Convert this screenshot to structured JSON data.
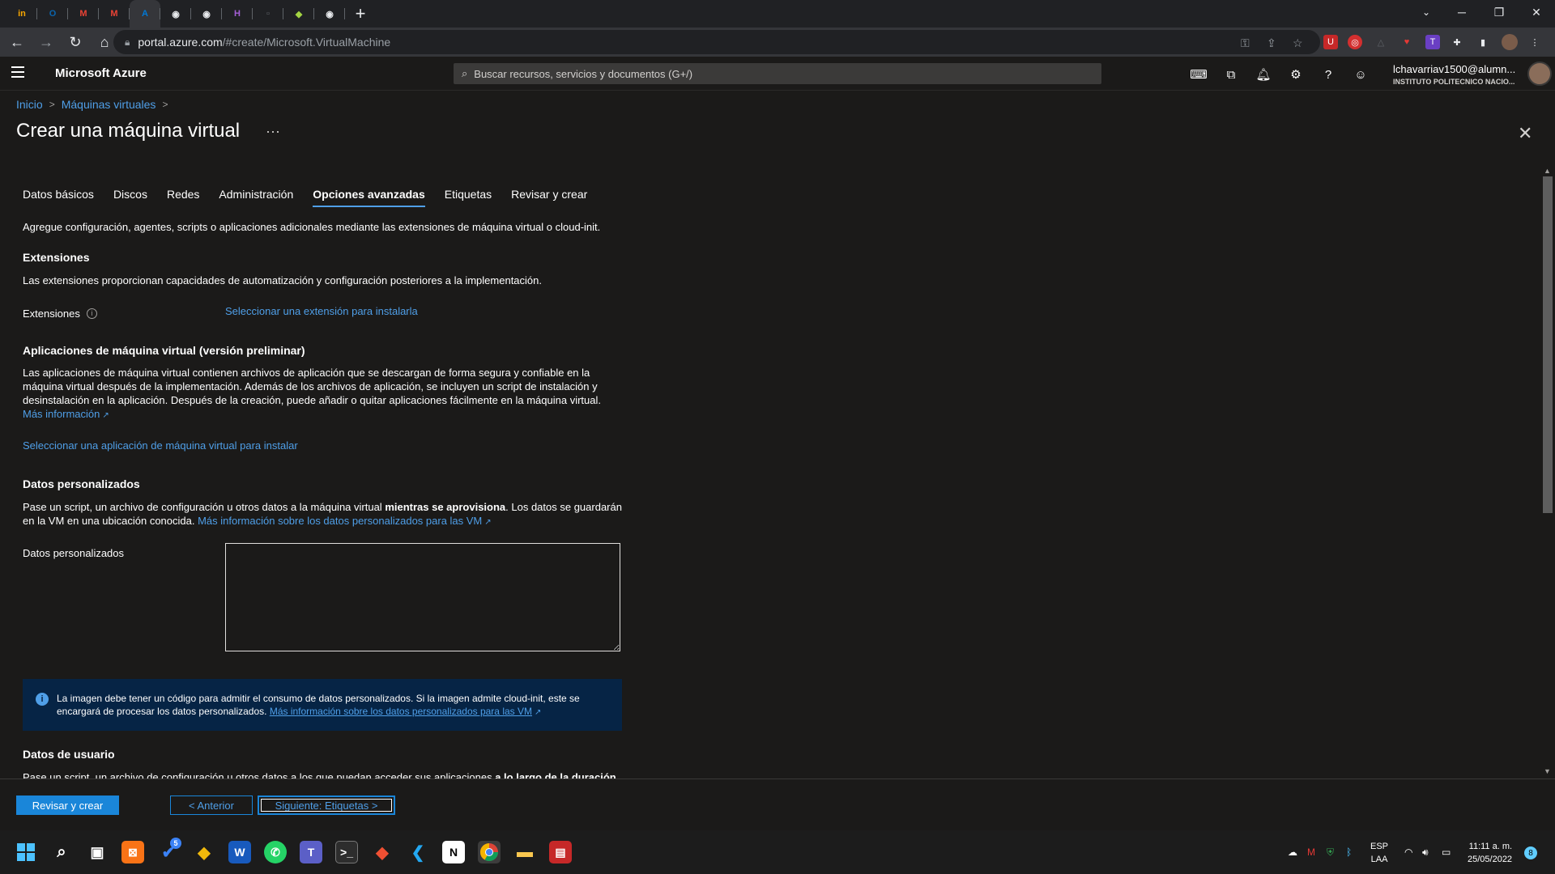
{
  "browser": {
    "tabs": [
      {
        "icon": "indeed-icon",
        "glyph": "in",
        "color": "#f7a600",
        "active": false
      },
      {
        "icon": "outlook-icon",
        "glyph": "O",
        "color": "#0a64ad",
        "active": false
      },
      {
        "icon": "gmail-icon",
        "glyph": "M",
        "color": "#ea4335",
        "active": false
      },
      {
        "icon": "gmail-icon",
        "glyph": "M",
        "color": "#ea4335",
        "active": false
      },
      {
        "icon": "azure-icon",
        "glyph": "A",
        "color": "#0078d4",
        "active": true
      },
      {
        "icon": "globe-icon",
        "glyph": "◉",
        "color": "#e8eaed",
        "active": false
      },
      {
        "icon": "globe-icon",
        "glyph": "◉",
        "color": "#e8eaed",
        "active": false
      },
      {
        "icon": "hackmd-icon",
        "glyph": "H",
        "color": "#a55fd6",
        "active": false
      },
      {
        "icon": "blank-page-icon",
        "glyph": "▫",
        "color": "#5f6368",
        "active": false
      },
      {
        "icon": "diamond-icon",
        "glyph": "◆",
        "color": "#a3d443",
        "active": false
      },
      {
        "icon": "globe-icon",
        "glyph": "◉",
        "color": "#e8eaed",
        "active": false
      }
    ],
    "new_tab_glyph": "+",
    "address": {
      "domain": "portal.azure.com",
      "path": "/#create/Microsoft.VirtualMachine"
    }
  },
  "azure": {
    "brand": "Microsoft Azure",
    "search_placeholder": "Buscar recursos, servicios y documentos (G+/)",
    "user_name": "lchavarriav1500@alumn...",
    "user_org": "INSTITUTO POLITECNICO NACIO..."
  },
  "breadcrumb": {
    "items": [
      "Inicio",
      "Máquinas virtuales"
    ],
    "sep": ">"
  },
  "page": {
    "title": "Crear una máquina virtual",
    "ellipsis": "···",
    "close": "✕"
  },
  "tabs": [
    {
      "label": "Datos básicos",
      "selected": false
    },
    {
      "label": "Discos",
      "selected": false
    },
    {
      "label": "Redes",
      "selected": false
    },
    {
      "label": "Administración",
      "selected": false
    },
    {
      "label": "Opciones avanzadas",
      "selected": true
    },
    {
      "label": "Etiquetas",
      "selected": false
    },
    {
      "label": "Revisar y crear",
      "selected": false
    }
  ],
  "content": {
    "intro": "Agregue configuración, agentes, scripts o aplicaciones adicionales mediante las extensiones de máquina virtual o cloud-init.",
    "extensions": {
      "heading": "Extensiones",
      "description": "Las extensiones proporcionan capacidades de automatización y configuración posteriores a la implementación.",
      "label": "Extensiones",
      "info_glyph": "i",
      "link": "Seleccionar una extensión para instalarla"
    },
    "vm_apps": {
      "heading": "Aplicaciones de máquina virtual (versión preliminar)",
      "description": "Las aplicaciones de máquina virtual contienen archivos de aplicación que se descargan de forma segura y confiable en la máquina virtual después de la implementación. Además de los archivos de aplicación, se incluyen un script de instalación y desinstalación en la aplicación. Después de la creación, puede añadir o quitar aplicaciones fácilmente en la máquina virtual.",
      "more_link": "Más información",
      "select_link": "Seleccionar una aplicación de máquina virtual para instalar"
    },
    "custom_data": {
      "heading": "Datos personalizados",
      "desc_before": "Pase un script, un archivo de configuración u otros datos a la máquina virtual ",
      "desc_bold": "mientras se aprovisiona",
      "desc_after": ". Los datos se guardarán en la VM en una ubicación conocida. ",
      "desc_link": "Más información sobre los datos personalizados para las VM",
      "field_label": "Datos personalizados",
      "value": "",
      "info_text": "La imagen debe tener un código para admitir el consumo de datos personalizados. Si la imagen admite cloud-init, este se encargará de procesar los datos personalizados. ",
      "info_link": "Más información sobre los datos personalizados para las VM"
    },
    "user_data": {
      "heading": "Datos de usuario",
      "desc_before": "Pase un script, un archivo de configuración u otros datos a los que puedan acceder sus aplicaciones ",
      "desc_bold": "a lo largo de la duración"
    }
  },
  "buttons": {
    "review": "Revisar y crear",
    "prev": "< Anterior",
    "next": "Siguiente: Etiquetas >"
  },
  "taskbar": {
    "lang_top": "ESP",
    "lang_bottom": "LAA",
    "time": "11:11 a. m.",
    "date": "25/05/2022",
    "notifications": "8",
    "steam_badge": "5"
  }
}
